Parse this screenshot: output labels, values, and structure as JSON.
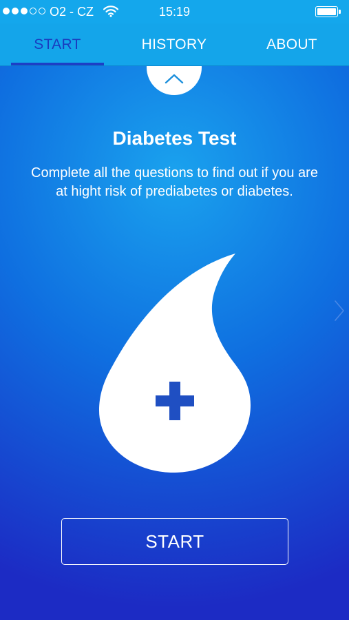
{
  "status_bar": {
    "signal_strength": 3,
    "signal_max": 5,
    "carrier": "O2 - CZ",
    "wifi_icon": "wifi-icon",
    "time": "15:19",
    "battery_icon": "battery-icon",
    "battery_level": 1.0
  },
  "tabs": [
    {
      "label": "START",
      "active": true
    },
    {
      "label": "HISTORY",
      "active": false
    },
    {
      "label": "ABOUT",
      "active": false
    }
  ],
  "collapse_icon": "chevron-up-icon",
  "main": {
    "title": "Diabetes Test",
    "description": "Complete all the questions to find out if you are at hight risk of prediabetes or diabetes.",
    "logo_icon": "blood-drop-plus-icon",
    "side_arrow_icon": "chevron-right-icon",
    "start_button": "START"
  },
  "colors": {
    "header_blue": "#14a7ec",
    "active_tab": "#1a3bbf",
    "background_top": "#1aa2ee",
    "background_bottom": "#1c2bc4",
    "plus_blue": "#1f4fc2",
    "white": "#ffffff"
  }
}
